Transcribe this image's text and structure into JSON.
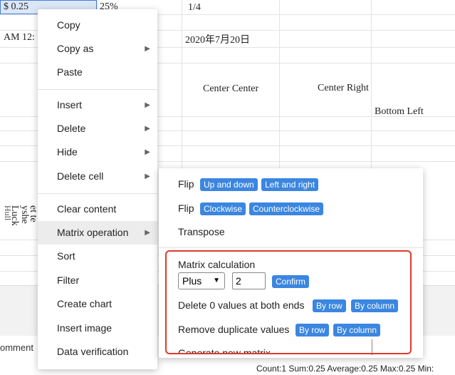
{
  "cells": {
    "a1": "$ 0.25",
    "b1": "25%",
    "d1": "1/4",
    "a2": "AM 12:",
    "d2": "2020年7月20日",
    "center_center": "Center Center",
    "center_right": "Center Right",
    "bottom_left": "Bottom Left",
    "vert1": "Luck",
    "vert2": "yshe",
    "vert3": "et te",
    "vert0": "Hull"
  },
  "sheet_tab": "omment",
  "statusbar": "Count:1   Sum:0.25   Average:0.25   Max:0.25   Min:",
  "context_menu": {
    "items": [
      {
        "label": "Copy",
        "arrow": ""
      },
      {
        "label": "Copy as",
        "arrow": "▶"
      },
      {
        "label": "Paste",
        "arrow": ""
      },
      {
        "label": "Insert",
        "arrow": "▶"
      },
      {
        "label": "Delete",
        "arrow": "▶"
      },
      {
        "label": "Hide",
        "arrow": "▶"
      },
      {
        "label": "Delete cell",
        "arrow": "▶"
      },
      {
        "label": "Clear content",
        "arrow": ""
      },
      {
        "label": "Matrix operation",
        "arrow": "▶"
      },
      {
        "label": "Sort",
        "arrow": ""
      },
      {
        "label": "Filter",
        "arrow": ""
      },
      {
        "label": "Create chart",
        "arrow": ""
      },
      {
        "label": "Insert image",
        "arrow": ""
      },
      {
        "label": "Data verification",
        "arrow": ""
      }
    ]
  },
  "submenu": {
    "flip_label_1": "Flip",
    "flip_up_down": "Up and down",
    "flip_left_right": "Left and right",
    "flip_label_2": "Flip",
    "clockwise": "Clockwise",
    "counterclockwise": "Counterclockwise",
    "transpose": "Transpose",
    "matrix_calc": "Matrix calculation",
    "operation_value": "Plus",
    "operand_value": "2",
    "confirm": "Confirm",
    "delete_zero": "Delete 0 values at both ends",
    "delete_by_row": "By row",
    "delete_by_column": "By column",
    "remove_dup": "Remove duplicate values",
    "dup_by_row": "By row",
    "dup_by_column": "By column",
    "generate": "Generate new matrix"
  }
}
